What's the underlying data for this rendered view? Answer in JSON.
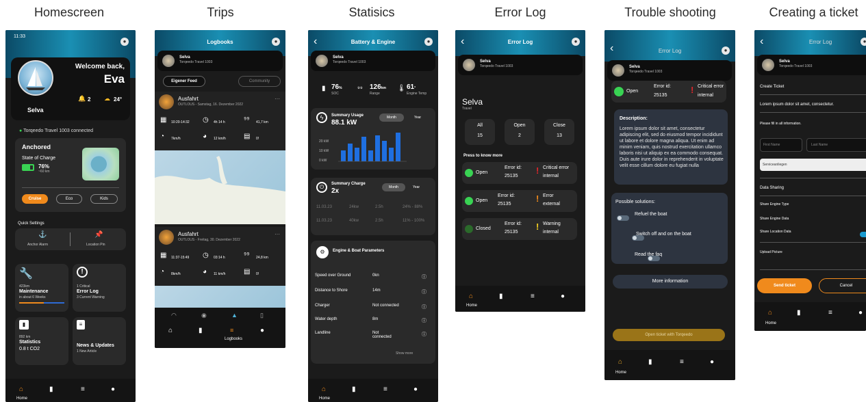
{
  "titles": [
    "Homescreen",
    "Trips",
    "Statisics",
    "Error Log",
    "Trouble shooting",
    "Creating a ticket"
  ],
  "home": {
    "time": "11:33",
    "welcome": "Welcome back,",
    "name": "Eva",
    "boat": "Selva",
    "notif_count": "2",
    "weather": "24°",
    "connected": "Torqeedo Travel 1003 connected",
    "status_title": "Anchored",
    "soc_label": "State of Charge",
    "soc_value": "76%",
    "soc_range": "~60 km",
    "modes": [
      "Cruise",
      "Eco",
      "Kids"
    ],
    "quick_settings": "Quick Settings",
    "anchor_alarm": "Anchor Alarm",
    "location_pin": "Location Pin",
    "tiles": [
      {
        "top": "423km",
        "title": "Maintenance",
        "sub": "in about 6 Weeks"
      },
      {
        "top": "1 Critical",
        "title": "Error Log",
        "sub": "3 Current Warning"
      },
      {
        "top": "892 km",
        "title": "Statistics",
        "sub": "0.8 t CO2"
      },
      {
        "top": "",
        "title": "News & Updates",
        "sub": "1 New Article"
      }
    ],
    "nav_home": "Home"
  },
  "trips": {
    "header": "Logbooks",
    "boat": "Selva",
    "boat_sub": "Torqeedo Travel 1003",
    "tab_own": "Eigener Feed",
    "tab_community": "Community",
    "entries": [
      {
        "title": "Ausfahrt",
        "sub": "OUTLOUS - Samstag, 16. Dezember 2022",
        "time": "10:20-14:32",
        "dur": "4h 14 h",
        "dist": "41,7 km",
        "speed": "7km/h",
        "max": "12 km/h",
        "wind": "0!"
      },
      {
        "title": "Ausfahrt",
        "sub": "OUTLOUS - Freitag, 30. Dezember 2022",
        "time": "11:37-15:49",
        "dur": "03:14 h",
        "dist": "24,8 km",
        "speed": "8km/h",
        "max": "11 km/h",
        "wind": "0!"
      }
    ],
    "nav_label": "Logbooks"
  },
  "stats": {
    "header": "Battery & Engine",
    "boat": "Selva",
    "boat_sub": "Torqeedo Travel 1003",
    "soc": "76",
    "soc_unit": "%",
    "soc_lbl": "SOC",
    "range": "126",
    "range_unit": "km",
    "range_lbl": "Range",
    "temp": "61",
    "temp_unit": "°",
    "temp_lbl": "Engine Temp",
    "usage_title": "Summary Usage",
    "usage_value": "88.1 kW",
    "month": "Month",
    "year": "Year",
    "y_ticks": [
      "20 kW",
      "10 kW",
      "0 kW"
    ],
    "charge_title": "Summary Charge",
    "charge_value": "2x",
    "charge_rows": [
      [
        "11.03.23",
        "24kw",
        "2.5h",
        "24% - 88%"
      ],
      [
        "11.03.23",
        "40kw",
        "2.5h",
        "11% - 100%"
      ]
    ],
    "params_title": "Engine & Boat Parameters",
    "params": [
      [
        "Speed over Ground",
        "0kn"
      ],
      [
        "Distance to Shore",
        "14m"
      ],
      [
        "Charger",
        "Not connected"
      ],
      [
        "Water depth",
        "8m"
      ],
      [
        "Landline",
        "Not connected"
      ]
    ],
    "show_more": "Show more",
    "nav_home": "Home"
  },
  "errorlog": {
    "header": "Error Log",
    "boat": "Selva",
    "boat_sub": "Torqeedo Travel 1003",
    "big_name": "Selva",
    "big_sub": "Travel",
    "counts": [
      {
        "label": "All",
        "value": "15"
      },
      {
        "label": "Open",
        "value": "2"
      },
      {
        "label": "Close",
        "value": "13"
      }
    ],
    "press": "Press to know more",
    "errors": [
      {
        "state": "Open",
        "id_label": "Error id:",
        "id": "25135",
        "level": "Critical error",
        "type": "internal"
      },
      {
        "state": "Open",
        "id_label": "Error id:",
        "id": "25135",
        "level": "Error",
        "type": "external"
      },
      {
        "state": "Closed",
        "id_label": "Error id:",
        "id": "25135",
        "level": "Warning",
        "type": "internal"
      }
    ],
    "nav_home": "Home"
  },
  "trouble": {
    "header": "Error Log",
    "boat": "Selva",
    "boat_sub": "Torqeedo Travel 1003",
    "state": "Open",
    "id_label": "Error id:",
    "id": "25135",
    "level": "Critical error",
    "type": "internal",
    "desc_title": "Description:",
    "desc": "Lorem ipsum dolor sit amet, consectetur adipiscing elit, sed do eiusmod tempor incididunt ut labore et dolore magna aliqua. Ut enim ad minim veniam, quis nostrud exercitation ullamco laboris nisi ut aliquip ex ea commodo consequat. Duis aute irure dolor in reprehenderit in voluptate velit esse cillum dolore eu fugiat nulla",
    "solutions_title": "Possible solutions:",
    "solutions": [
      "Refuel the boat",
      "Switch off and on the boat",
      "Read the faq"
    ],
    "more_info": "More information",
    "open_ticket": "Open ticket with Torqeedo",
    "nav_home": "Home"
  },
  "ticket": {
    "header": "Error Log",
    "boat": "Selva",
    "boat_sub": "Torqeedo Travel 1003",
    "create": "Create Ticket",
    "lorem": "Lorem ipsum dolor sit amet, consectetur.",
    "fill": "Please fill in all information.",
    "first_name": "First Name",
    "last_name": "Last Name",
    "service": "Serviceanliegen",
    "sharing": "Data Sharing",
    "share_items": [
      "Share Engine Type",
      "Share Engine Data",
      "Share Location Data"
    ],
    "upload": "Upload Picture",
    "send": "Send ticket",
    "cancel": "Cancel",
    "nav_home": "Home"
  }
}
